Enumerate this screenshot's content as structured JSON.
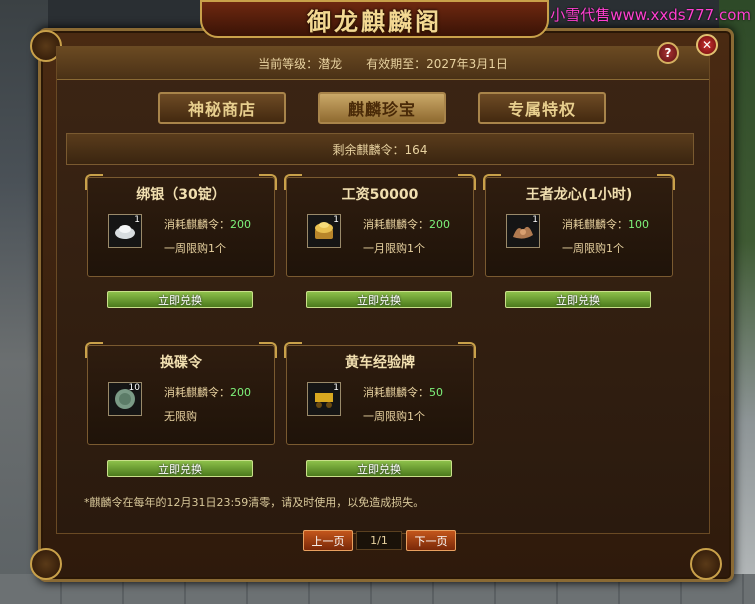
{
  "watermark": "小雪代售www.xxds777.com",
  "window": {
    "title": "御龙麒麟阁",
    "current_level_label": "当前等级：潜龙",
    "valid_until_label": "有效期至：2027年3月1日",
    "help": "?",
    "close": "✕"
  },
  "tabs": [
    {
      "label": "神秘商店",
      "active": false
    },
    {
      "label": "麒麟珍宝",
      "active": true
    },
    {
      "label": "专属特权",
      "active": false
    }
  ],
  "remaining": "剩余麒麟令：164",
  "items": [
    {
      "name": "绑银（30锭）",
      "icon": "silver-ingot-icon",
      "qty": "1",
      "cost_label": "消耗麒麟令：",
      "cost": "200",
      "limit": "一周限购1个",
      "button": "立即兑换"
    },
    {
      "name": "工资50000",
      "icon": "gold-coins-icon",
      "qty": "1",
      "cost_label": "消耗麒麟令：",
      "cost": "200",
      "limit": "一月限购1个",
      "button": "立即兑换"
    },
    {
      "name": "王者龙心(1小时)",
      "icon": "dragon-heart-icon",
      "qty": "1",
      "cost_label": "消耗麒麟令：",
      "cost": "100",
      "limit": "一周限购1个",
      "button": "立即兑换"
    },
    {
      "name": "换碟令",
      "icon": "token-icon",
      "qty": "10",
      "cost_label": "消耗麒麟令：",
      "cost": "200",
      "limit": "无限购",
      "button": "立即兑换"
    },
    {
      "name": "黄车经验牌",
      "icon": "golden-cart-icon",
      "qty": "1",
      "cost_label": "消耗麒麟令：",
      "cost": "50",
      "limit": "一周限购1个",
      "button": "立即兑换"
    }
  ],
  "note": "*麒麟令在每年的12月31日23:59清零，请及时使用，以免造成损失。",
  "pager": {
    "prev": "上一页",
    "page": "1/1",
    "next": "下一页"
  }
}
